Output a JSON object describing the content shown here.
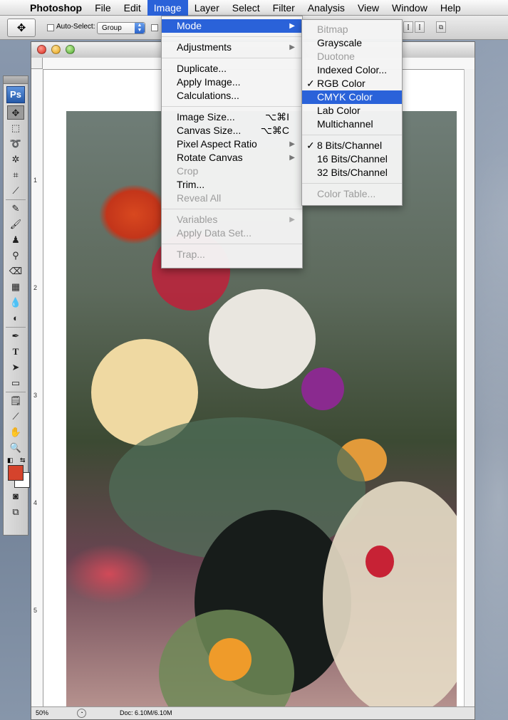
{
  "menubar": {
    "app": "Photoshop",
    "items": [
      "File",
      "Edit",
      "Image",
      "Layer",
      "Select",
      "Filter",
      "Analysis",
      "View",
      "Window",
      "Help"
    ],
    "active": "Image"
  },
  "options": {
    "auto_select_label": "Auto-Select:",
    "group_value": "Group"
  },
  "tools_palette": {
    "logo": "Ps"
  },
  "document": {
    "zoom": "50%",
    "doc_size": "Doc: 6.10M/6.10M",
    "ruler_v_numbers": [
      "1",
      "2",
      "3",
      "4",
      "5"
    ]
  },
  "image_menu": {
    "mode": "Mode",
    "adjustments": "Adjustments",
    "duplicate": "Duplicate...",
    "apply_image": "Apply Image...",
    "calculations": "Calculations...",
    "image_size": "Image Size...",
    "image_size_sc": "⌥⌘I",
    "canvas_size": "Canvas Size...",
    "canvas_size_sc": "⌥⌘C",
    "pixel_aspect_ratio": "Pixel Aspect Ratio",
    "rotate_canvas": "Rotate Canvas",
    "crop": "Crop",
    "trim": "Trim...",
    "reveal_all": "Reveal All",
    "variables": "Variables",
    "apply_data_set": "Apply Data Set...",
    "trap": "Trap..."
  },
  "mode_menu": {
    "bitmap": "Bitmap",
    "grayscale": "Grayscale",
    "duotone": "Duotone",
    "indexed_color": "Indexed Color...",
    "rgb_color": "RGB Color",
    "cmyk_color": "CMYK Color",
    "lab_color": "Lab Color",
    "multichannel": "Multichannel",
    "bits8": "8 Bits/Channel",
    "bits16": "16 Bits/Channel",
    "bits32": "32 Bits/Channel",
    "color_table": "Color Table...",
    "check_mark": "✓"
  },
  "colors": {
    "highlight": "#2a62d9",
    "foreground_swatch": "#d5432c",
    "background_swatch": "#ffffff"
  }
}
